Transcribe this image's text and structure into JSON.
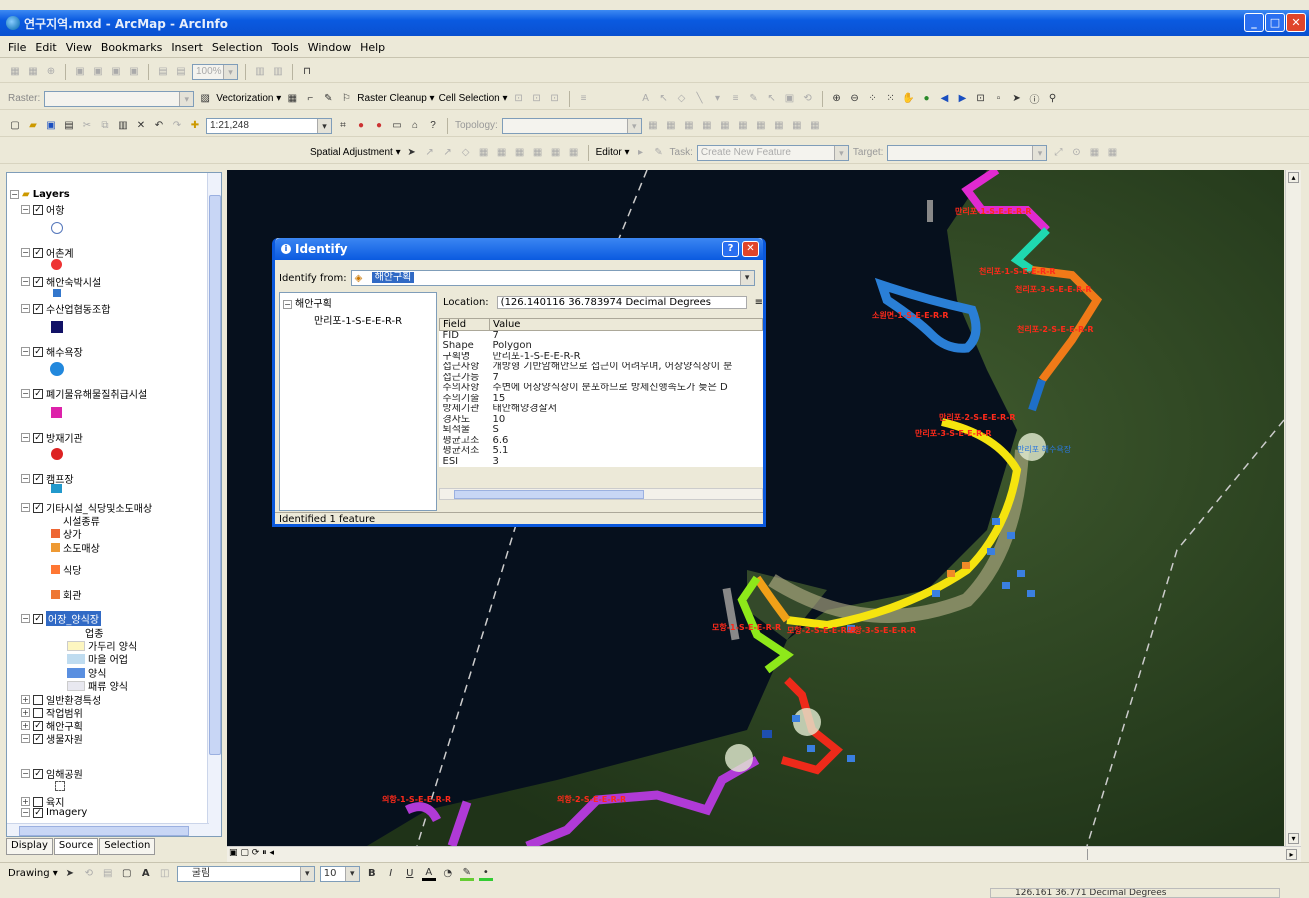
{
  "window": {
    "title": "연구지역.mxd - ArcMap - ArcInfo"
  },
  "menu": [
    "File",
    "Edit",
    "View",
    "Bookmarks",
    "Insert",
    "Selection",
    "Tools",
    "Window",
    "Help"
  ],
  "toolbar1": {
    "zoom": "100%"
  },
  "toolbar2": {
    "raster_label": "Raster:",
    "vectorization": "Vectorization ▾",
    "raster_cleanup": "Raster Cleanup ▾",
    "cell_selection": "Cell Selection ▾"
  },
  "toolbar3": {
    "scale": "1:21,248",
    "topology_label": "Topology:"
  },
  "toolbar4": {
    "spatial_adjustment": "Spatial Adjustment ▾",
    "editor": "Editor ▾",
    "task_label": "Task:",
    "task_value": "Create New Feature",
    "target_label": "Target:"
  },
  "toc": {
    "title": "Layers",
    "items": [
      {
        "label": "어항"
      },
      {
        "label": "어촌계"
      },
      {
        "label": "해안숙박시설"
      },
      {
        "label": "수산업협동조합"
      },
      {
        "label": "해수욕장"
      },
      {
        "label": "폐기물유해물질취급시설"
      },
      {
        "label": "방재기관"
      },
      {
        "label": "캠프장"
      },
      {
        "label": "기타시설_식당및소도매상"
      },
      {
        "label": "시설종류"
      },
      {
        "label": "상가"
      },
      {
        "label": "소도매상"
      },
      {
        "label": "식당"
      },
      {
        "label": "회관"
      },
      {
        "label": "어장_양식장"
      },
      {
        "label": "업종"
      },
      {
        "label": "가두리 양식"
      },
      {
        "label": "마을 어업"
      },
      {
        "label": "양식"
      },
      {
        "label": "패류 양식"
      },
      {
        "label": "일반환경특성"
      },
      {
        "label": "작업범위"
      },
      {
        "label": "해안구획"
      },
      {
        "label": "생물자원"
      },
      {
        "label": "임해공원"
      },
      {
        "label": "육지"
      },
      {
        "label": "Imagery"
      }
    ]
  },
  "toc_tabs": [
    "Display",
    "Source",
    "Selection"
  ],
  "identify": {
    "title": "Identify",
    "from_label": "Identify from:",
    "from_value": "해안구획",
    "tree_root": "해안구획",
    "tree_child": "만리포-1-S-E-E-R-R",
    "location_label": "Location:",
    "location_value": "(126.140116  36.783974 Decimal Degrees",
    "columns": [
      "Field",
      "Value"
    ],
    "rows": [
      [
        "FID",
        "7"
      ],
      [
        "Shape",
        "Polygon"
      ],
      [
        "구획명",
        "만리포-1-S-E-E-R-R"
      ],
      [
        "접근사항",
        "개방형 기반암해안으로 접근이 어려우며, 어장양식장이 분"
      ],
      [
        "접근가능",
        "7"
      ],
      [
        "주의사항",
        "주변에 어장양식장이 분포하므로 방제진행속도가 늦은 D"
      ],
      [
        "주의기술",
        "15"
      ],
      [
        "방제기관",
        "태안해양경찰서"
      ],
      [
        "경사도",
        "10"
      ],
      [
        "퇴적물",
        "S"
      ],
      [
        "평균고조",
        "6.6"
      ],
      [
        "평균저조",
        "5.1"
      ],
      [
        "ESI",
        "3"
      ]
    ],
    "status": "Identified 1 feature"
  },
  "map_labels": [
    {
      "text": "만리포-1-S-E-E-R-R"
    },
    {
      "text": "천리포-3-S-E-E-R-R"
    },
    {
      "text": "천리포-1-S-E-E-R-R"
    },
    {
      "text": "소원면-1-S-E-E-R-R"
    },
    {
      "text": "천리포-2-S-E-E-R-R"
    },
    {
      "text": "만리포-2-S-E-E-R-R"
    },
    {
      "text": "만리포-3-S-E-E-R-R"
    },
    {
      "text": "만리포 해수욕장"
    },
    {
      "text": "모항-1-S-E-E-R-R"
    },
    {
      "text": "모항-2-S-E-E-R-R"
    },
    {
      "text": "모항-3-S-E-E-R-R"
    },
    {
      "text": "의항-1-S-E-E-R-R"
    },
    {
      "text": "의항-2-S-E-E-R-R"
    }
  ],
  "drawing": {
    "label": "Drawing ▾",
    "font": "굴림",
    "size": "10"
  },
  "status": {
    "coords": "126.161  36.771 Decimal Degrees"
  },
  "colors": {
    "title_blue": "#0a5ae0",
    "sea": "#06101d"
  }
}
